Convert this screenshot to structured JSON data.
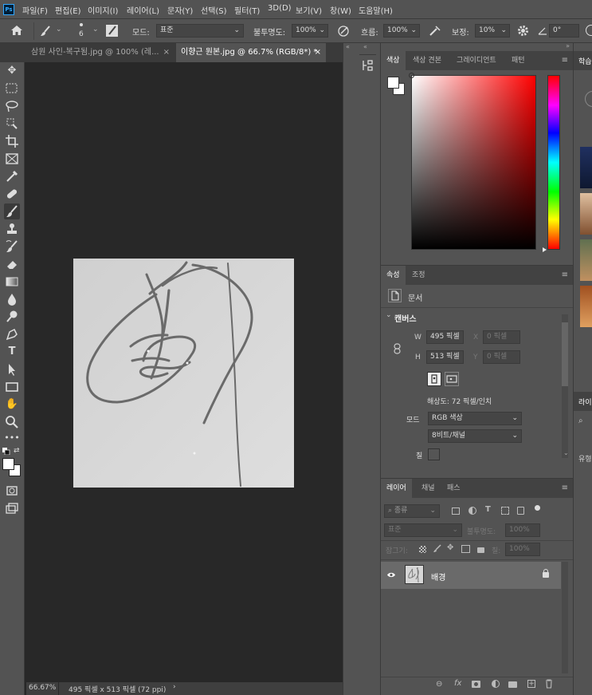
{
  "app": {
    "logo": "Ps"
  },
  "menu": [
    "파일(F)",
    "편집(E)",
    "이미지(I)",
    "레이어(L)",
    "문자(Y)",
    "선택(S)",
    "필터(T)",
    "3D(D)",
    "보기(V)",
    "창(W)",
    "도움말(H)"
  ],
  "options": {
    "brush_size": "6",
    "mode_label": "모드:",
    "mode_value": "표준",
    "opacity_label": "불투명도:",
    "opacity_value": "100%",
    "flow_label": "흐름:",
    "flow_value": "100%",
    "smoothing_label": "보정:",
    "smoothing_value": "10%",
    "angle_value": "0°"
  },
  "tabs": [
    {
      "label": "삼원 사인-복구됨.jpg @ 100% (레...",
      "close": "×",
      "active": false
    },
    {
      "label": "이향근 원본.jpg @ 66.7% (RGB/8*) *",
      "close": "×",
      "active": true
    }
  ],
  "status": {
    "zoom": "66.67%",
    "doc_info": "495 픽셀 x 513 픽셀 (72 ppi)",
    "arrow": "›"
  },
  "color_panel": {
    "tabs": [
      "색상",
      "색상 견본",
      "그레이디언트",
      "패턴"
    ],
    "foreground": "#ffffff",
    "background": "#ffffff",
    "hue_color": "#ff0000"
  },
  "properties_panel": {
    "tabs": [
      "속성",
      "조정"
    ],
    "doc_label": "문서",
    "canvas_section": "캔버스",
    "w_label": "W",
    "w_value": "495 픽셀",
    "h_label": "H",
    "h_value": "513 픽셀",
    "x_label": "X",
    "x_value": "0 픽셀",
    "y_label": "Y",
    "y_value": "0 픽셀",
    "resolution": "해상도: 72 픽셀/인치",
    "mode_label": "모드",
    "mode_value": "RGB 색상",
    "depth_value": "8비트/채널",
    "fill_label": "칠"
  },
  "layers_panel": {
    "tabs": [
      "레이어",
      "채널",
      "패스"
    ],
    "filter_label": "종류",
    "blend_value": "표준",
    "opacity_label": "불투명도:",
    "opacity_value": "100%",
    "lock_label": "잠그기:",
    "fill_label": "칠:",
    "fill_value": "100%",
    "layers": [
      {
        "name": "배경",
        "visible": true,
        "locked": true
      }
    ]
  },
  "far_right": {
    "tab1": "학습",
    "tab2": "라이",
    "label3": "유형"
  }
}
